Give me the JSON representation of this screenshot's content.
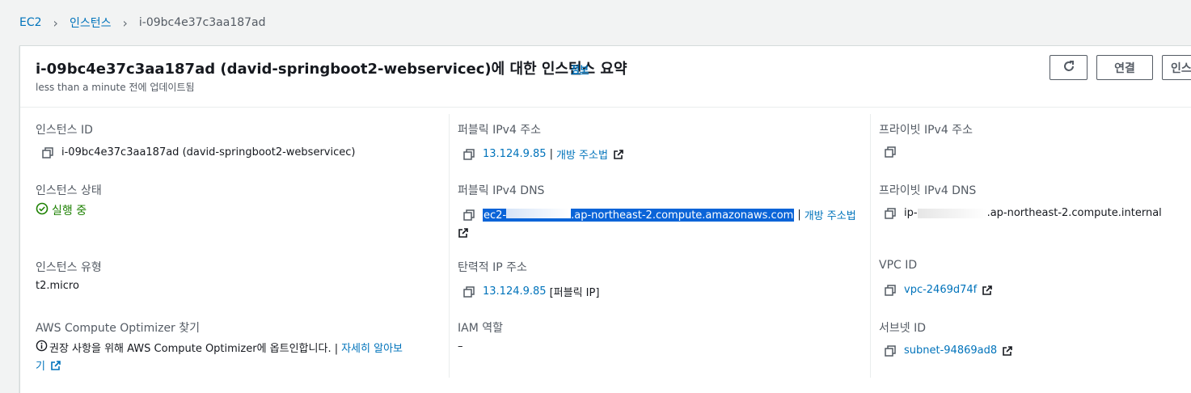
{
  "breadcrumb": {
    "root": "EC2",
    "instances": "인스턴스",
    "current": "i-09bc4e37c3aa187ad"
  },
  "header": {
    "title": "i-09bc4e37c3aa187ad (david-springboot2-webservicec)에 대한 인스턴스 요약",
    "info": "정보",
    "subtitle": "less than a minute 전에 업데이트됨",
    "connect": "연결",
    "more": "인스"
  },
  "details": {
    "instance_id_label": "인스턴스 ID",
    "instance_id_value": "i-09bc4e37c3aa187ad (david-springboot2-webservicec)",
    "instance_state_label": "인스턴스 상태",
    "instance_state_value": "실행 중",
    "instance_type_label": "인스턴스 유형",
    "instance_type_value": "t2.micro",
    "optimizer_label": "AWS Compute Optimizer 찾기",
    "optimizer_text": "권장 사항을 위해 AWS Compute Optimizer에 옵트인합니다. |",
    "optimizer_link_1": "자세히 알아보",
    "optimizer_link_2": "기",
    "public_ipv4_label": "퍼블릭 IPv4 주소",
    "public_ipv4_value": "13.124.9.85",
    "open_address": "개방 주소법",
    "public_dns_label": "퍼블릭 IPv4 DNS",
    "public_dns_prefix": "ec2-",
    "public_dns_suffix": ".ap-northeast-2.compute.amazonaws.com",
    "elastic_ip_label": "탄력적 IP 주소",
    "elastic_ip_value": "13.124.9.85",
    "elastic_ip_suffix": "[퍼블릭 IP]",
    "iam_role_label": "IAM 역할",
    "iam_role_value": "–",
    "private_ipv4_label": "프라이빗 IPv4 주소",
    "private_dns_label": "프라이빗 IPv4 DNS",
    "private_dns_prefix": "ip-",
    "private_dns_suffix": ".ap-northeast-2.compute.internal",
    "vpc_label": "VPC ID",
    "vpc_value": "vpc-2469d74f",
    "subnet_label": "서브넷 ID",
    "subnet_value": "subnet-94869ad8",
    "pipe": "|"
  },
  "colors": {
    "link": "#0073bb",
    "success": "#1d8102",
    "highlight": "#0a64d8"
  }
}
